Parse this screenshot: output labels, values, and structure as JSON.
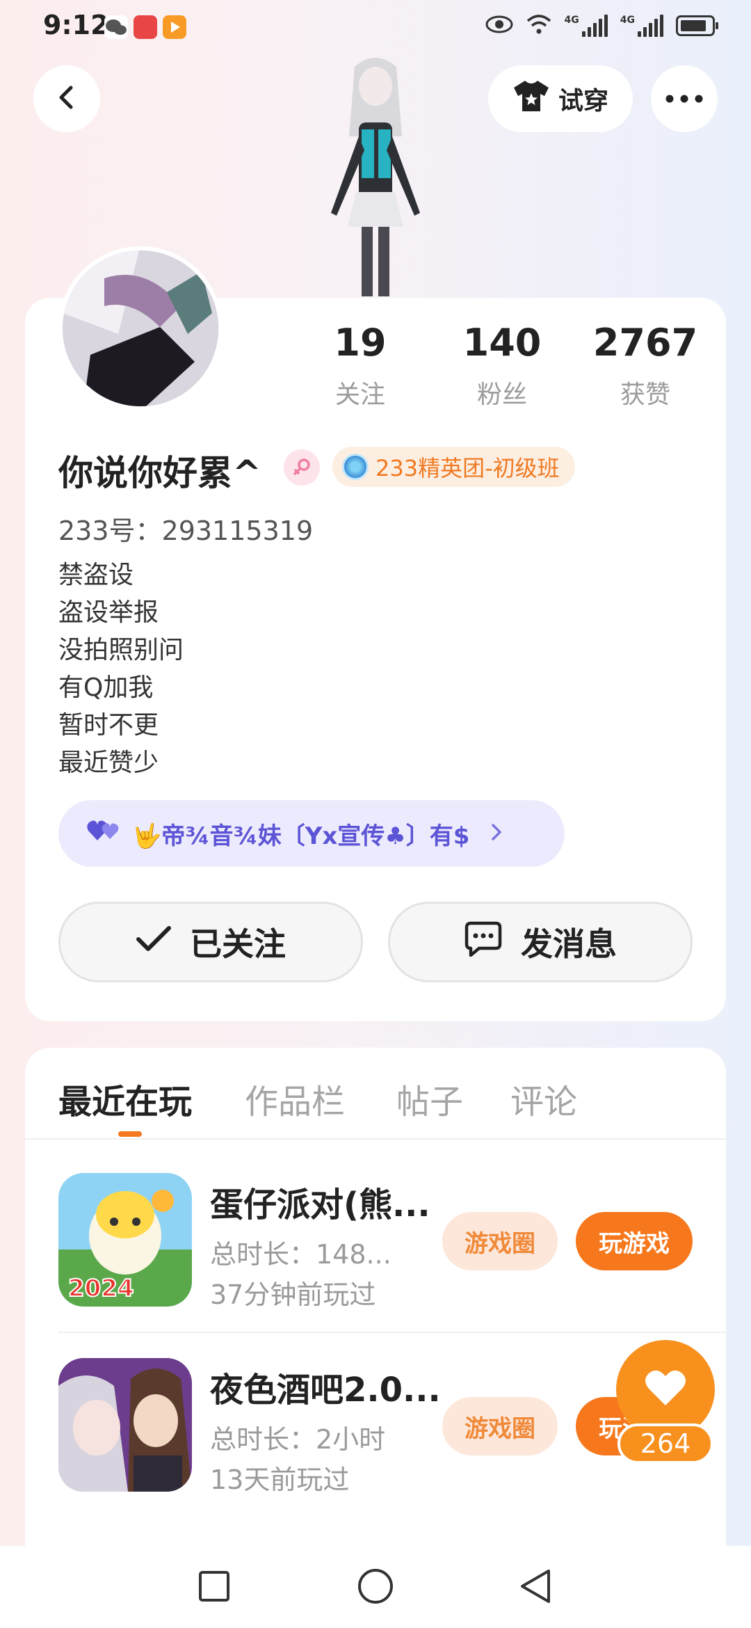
{
  "status_bar": {
    "time": "9:12",
    "network_1": "4G",
    "network_2": "4G"
  },
  "header": {
    "back_icon": "chevron-left-icon",
    "tryon_label": "试穿",
    "more_icon": "more-dots-icon"
  },
  "profile": {
    "stats": [
      {
        "value": "19",
        "label": "关注"
      },
      {
        "value": "140",
        "label": "粉丝"
      },
      {
        "value": "2767",
        "label": "获赞"
      }
    ],
    "username": "你说你好累^",
    "rank_badge": "233精英团-初级班",
    "id_line": "233号：293115319",
    "bio_lines": [
      "禁盗设",
      "盗设举报",
      "没拍照别问",
      "有Q加我",
      "暂时不更",
      "最近赞少"
    ],
    "group_label": "🤟帝¾音¾妹〔Yx宣传♣〕有$",
    "follow_label": "已关注",
    "message_label": "发消息"
  },
  "tabs": [
    {
      "label": "最近在玩",
      "active": true
    },
    {
      "label": "作品栏",
      "active": false
    },
    {
      "label": "帖子",
      "active": false
    },
    {
      "label": "评论",
      "active": false
    }
  ],
  "games": [
    {
      "title": "蛋仔派对(熊...",
      "duration": "总时长：148...",
      "last_played": "37分钟前玩过",
      "icon_text": "2024",
      "circle_label": "游戏圈",
      "play_label": "玩游戏"
    },
    {
      "title": "夜色酒吧2.0...",
      "duration": "总时长：2小时",
      "last_played": "13天前玩过",
      "circle_label": "游戏圈",
      "play_label": "玩游戏"
    }
  ],
  "like": {
    "count": "264"
  },
  "colors": {
    "accent": "#f7781c",
    "group_text": "#5c54d6",
    "rank_text": "#f07a22"
  }
}
